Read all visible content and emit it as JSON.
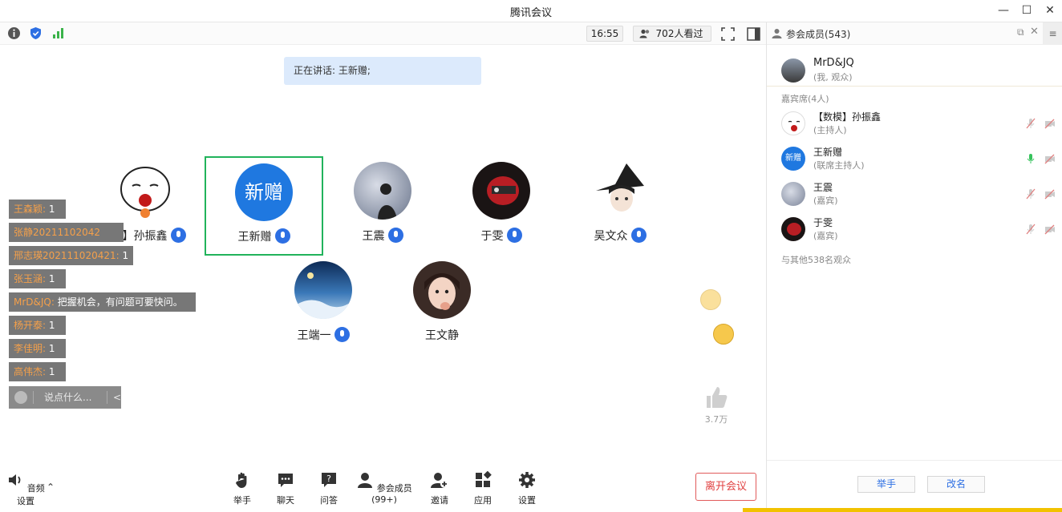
{
  "window": {
    "title": "腾讯会议",
    "minimize": "—",
    "maximize": "☐",
    "close": "✕"
  },
  "topbar": {
    "time": "16:55",
    "viewers": "702人看过",
    "icons": [
      "info-icon",
      "security-shield-icon",
      "signal-icon",
      "fullscreen-icon",
      "layout-icon"
    ]
  },
  "speaking": "正在讲话: 王新赠;",
  "participants": [
    {
      "name": "【数模】孙振鑫",
      "avatar": "cartoon-face-avatar",
      "mic": true
    },
    {
      "name": "王新赠",
      "avatar_text": "新赠",
      "mic": true,
      "selected": true
    },
    {
      "name": "王震",
      "avatar": "dark-silhouette-avatar",
      "mic": true
    },
    {
      "name": "于雯",
      "avatar": "red-helmet-avatar",
      "mic": true
    },
    {
      "name": "吴文众",
      "avatar": "witch-hat-avatar",
      "mic": true
    },
    {
      "name": "王端一",
      "avatar": "blue-sky-avatar",
      "mic": true
    },
    {
      "name": "王文静",
      "avatar": "girl-photo-avatar",
      "mic": false
    }
  ],
  "chat": [
    {
      "user": "王森颖:",
      "text": " 1"
    },
    {
      "user": "张静20211102042",
      "text": ""
    },
    {
      "user": "邢志瑛202111020421:",
      "text": " 1"
    },
    {
      "user": "张玉涵:",
      "text": " 1"
    },
    {
      "user": "MrD&JQ:",
      "text": " 把握机会，有问题可要快问。"
    },
    {
      "user": "杨开泰:",
      "text": " 1"
    },
    {
      "user": "李佳明:",
      "text": " 1"
    },
    {
      "user": "高伟杰:",
      "text": " 1"
    }
  ],
  "chat_input": {
    "placeholder": "说点什么...",
    "collapse": "<"
  },
  "likes": "3.7万",
  "toolbar": {
    "audio": "音频设置",
    "raise_hand": "举手",
    "chat": "聊天",
    "qa": "问答",
    "members": "参会成员(99+)",
    "invite": "邀请",
    "apps": "应用",
    "settings": "设置",
    "leave": "离开会议"
  },
  "panel": {
    "title": "参会成员(543)",
    "me": {
      "name": "MrD&JQ",
      "role": "(我, 观众)"
    },
    "guests_label": "嘉宾席(4人)",
    "guests": [
      {
        "name": "【数模】孙振鑫",
        "role": "(主持人)",
        "mic_on": false
      },
      {
        "name": "王新赠",
        "role": "(联席主持人)",
        "mic_on": true,
        "avatar_text": "新赠"
      },
      {
        "name": "王震",
        "role": "(嘉宾)",
        "mic_on": false
      },
      {
        "name": "于雯",
        "role": "(嘉宾)",
        "mic_on": false
      }
    ],
    "others": "与其他538名观众",
    "raise_hand": "举手",
    "rename": "改名"
  },
  "colors": {
    "accent": "#2d6fe3",
    "selected": "#21b35b",
    "leave": "#e04040"
  }
}
